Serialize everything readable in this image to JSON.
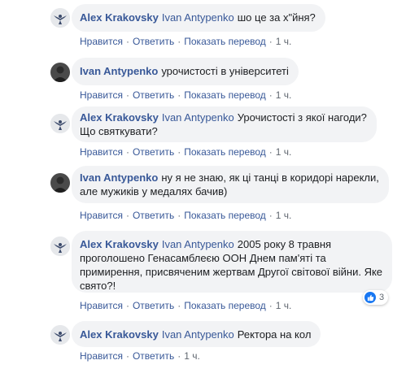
{
  "actions": {
    "like": "Нравится",
    "reply": "Ответить",
    "translate": "Показать перевод",
    "dot": "·"
  },
  "comments": [
    {
      "author": "Alex Krakovsky",
      "mention": "Ivan Antypenko",
      "text": "шо це за х\"йня?",
      "time": "1 ч.",
      "avatar": "eagle-avatar"
    },
    {
      "author": "Ivan Antypenko",
      "mention": "",
      "text": "урочистості в університеті",
      "time": "1 ч.",
      "avatar": "person-avatar"
    },
    {
      "author": "Alex Krakovsky",
      "mention": "Ivan Antypenko",
      "text": "Урочистості з якої нагоди?",
      "text2": "Що святкувати?",
      "time": "1 ч.",
      "avatar": "eagle-avatar"
    },
    {
      "author": "Ivan Antypenko",
      "mention": "",
      "text": "ну я не знаю, як ці танці в коридорі нарекли,",
      "text2": "але мужиків у медалях бачив)",
      "time": "1 ч.",
      "avatar": "person-avatar"
    },
    {
      "author": "Alex Krakovsky",
      "mention": "Ivan Antypenko",
      "text": "2005 року 8 травня",
      "text2": "проголошено Генасамблеєю ООН Днем пам'яті та",
      "text3": "примирення, присвяченим жертвам Другої світової війни. Яке",
      "text4": "свято?!",
      "time": "1 ч.",
      "avatar": "eagle-avatar",
      "reaction_count": "3"
    },
    {
      "author": "Alex Krakovsky",
      "mention": "Ivan Antypenko",
      "text": "Ректора на кол",
      "time": "1 ч.",
      "avatar": "eagle-avatar"
    }
  ],
  "colors": {
    "link": "#385898",
    "bubble": "#f2f3f5",
    "meta": "#606770",
    "like": "#1877f2"
  }
}
